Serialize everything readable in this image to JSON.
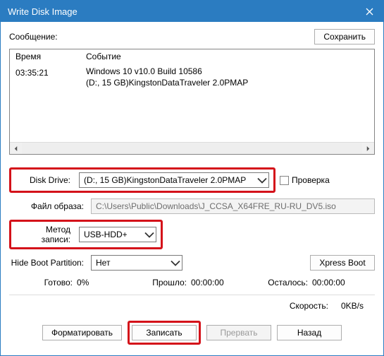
{
  "titlebar": {
    "title": "Write Disk Image"
  },
  "message_label": "Сообщение:",
  "buttons": {
    "save": "Сохранить",
    "xpress": "Xpress Boot",
    "format": "Форматировать",
    "write": "Записать",
    "abort": "Прервать",
    "back": "Назад"
  },
  "log": {
    "col_time": "Время",
    "col_event": "Событие",
    "time": "03:35:21",
    "event_lines": "Windows 10 v10.0 Build 10586\n(D:, 15 GB)KingstonDataTraveler 2.0PMAP"
  },
  "labels": {
    "disk_drive": "Disk Drive:",
    "image_file": "Файл образа:",
    "write_method": "Метод записи:",
    "hide_boot": "Hide Boot Partition:",
    "check": "Проверка"
  },
  "values": {
    "disk_drive": "(D:, 15 GB)KingstonDataTraveler 2.0PMAP",
    "image_file": "C:\\Users\\Public\\Downloads\\J_CCSA_X64FRE_RU-RU_DV5.iso",
    "write_method": "USB-HDD+",
    "hide_boot": "Нет"
  },
  "status": {
    "ready_label": "Готово:",
    "ready_value": "0%",
    "elapsed_label": "Прошло:",
    "elapsed_value": "00:00:00",
    "remain_label": "Осталось:",
    "remain_value": "00:00:00",
    "speed_label": "Скорость:",
    "speed_value": "0KB/s"
  }
}
